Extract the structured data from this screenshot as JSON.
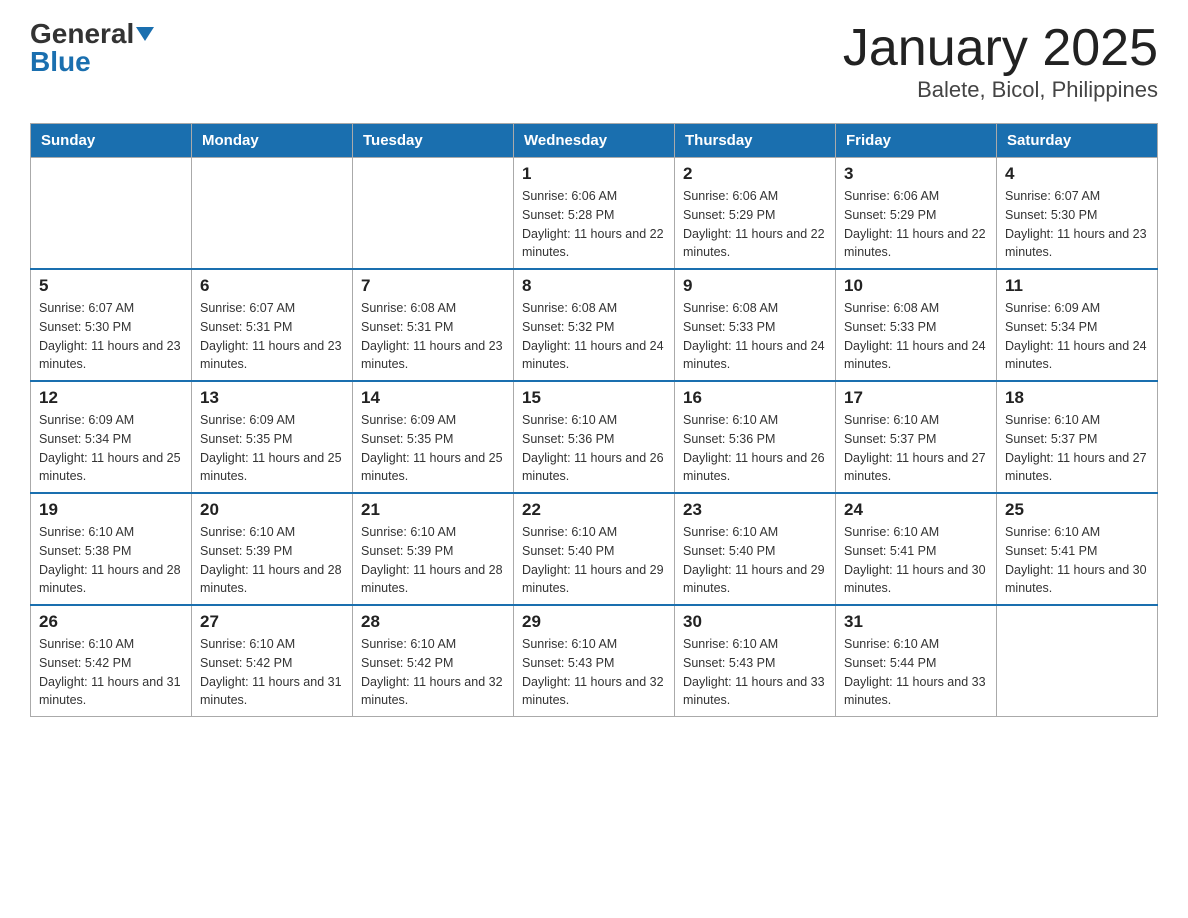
{
  "header": {
    "logo_general": "General",
    "logo_blue": "Blue",
    "title": "January 2025",
    "subtitle": "Balete, Bicol, Philippines"
  },
  "days_of_week": [
    "Sunday",
    "Monday",
    "Tuesday",
    "Wednesday",
    "Thursday",
    "Friday",
    "Saturday"
  ],
  "weeks": [
    [
      {
        "day": "",
        "sunrise": "",
        "sunset": "",
        "daylight": ""
      },
      {
        "day": "",
        "sunrise": "",
        "sunset": "",
        "daylight": ""
      },
      {
        "day": "",
        "sunrise": "",
        "sunset": "",
        "daylight": ""
      },
      {
        "day": "1",
        "sunrise": "Sunrise: 6:06 AM",
        "sunset": "Sunset: 5:28 PM",
        "daylight": "Daylight: 11 hours and 22 minutes."
      },
      {
        "day": "2",
        "sunrise": "Sunrise: 6:06 AM",
        "sunset": "Sunset: 5:29 PM",
        "daylight": "Daylight: 11 hours and 22 minutes."
      },
      {
        "day": "3",
        "sunrise": "Sunrise: 6:06 AM",
        "sunset": "Sunset: 5:29 PM",
        "daylight": "Daylight: 11 hours and 22 minutes."
      },
      {
        "day": "4",
        "sunrise": "Sunrise: 6:07 AM",
        "sunset": "Sunset: 5:30 PM",
        "daylight": "Daylight: 11 hours and 23 minutes."
      }
    ],
    [
      {
        "day": "5",
        "sunrise": "Sunrise: 6:07 AM",
        "sunset": "Sunset: 5:30 PM",
        "daylight": "Daylight: 11 hours and 23 minutes."
      },
      {
        "day": "6",
        "sunrise": "Sunrise: 6:07 AM",
        "sunset": "Sunset: 5:31 PM",
        "daylight": "Daylight: 11 hours and 23 minutes."
      },
      {
        "day": "7",
        "sunrise": "Sunrise: 6:08 AM",
        "sunset": "Sunset: 5:31 PM",
        "daylight": "Daylight: 11 hours and 23 minutes."
      },
      {
        "day": "8",
        "sunrise": "Sunrise: 6:08 AM",
        "sunset": "Sunset: 5:32 PM",
        "daylight": "Daylight: 11 hours and 24 minutes."
      },
      {
        "day": "9",
        "sunrise": "Sunrise: 6:08 AM",
        "sunset": "Sunset: 5:33 PM",
        "daylight": "Daylight: 11 hours and 24 minutes."
      },
      {
        "day": "10",
        "sunrise": "Sunrise: 6:08 AM",
        "sunset": "Sunset: 5:33 PM",
        "daylight": "Daylight: 11 hours and 24 minutes."
      },
      {
        "day": "11",
        "sunrise": "Sunrise: 6:09 AM",
        "sunset": "Sunset: 5:34 PM",
        "daylight": "Daylight: 11 hours and 24 minutes."
      }
    ],
    [
      {
        "day": "12",
        "sunrise": "Sunrise: 6:09 AM",
        "sunset": "Sunset: 5:34 PM",
        "daylight": "Daylight: 11 hours and 25 minutes."
      },
      {
        "day": "13",
        "sunrise": "Sunrise: 6:09 AM",
        "sunset": "Sunset: 5:35 PM",
        "daylight": "Daylight: 11 hours and 25 minutes."
      },
      {
        "day": "14",
        "sunrise": "Sunrise: 6:09 AM",
        "sunset": "Sunset: 5:35 PM",
        "daylight": "Daylight: 11 hours and 25 minutes."
      },
      {
        "day": "15",
        "sunrise": "Sunrise: 6:10 AM",
        "sunset": "Sunset: 5:36 PM",
        "daylight": "Daylight: 11 hours and 26 minutes."
      },
      {
        "day": "16",
        "sunrise": "Sunrise: 6:10 AM",
        "sunset": "Sunset: 5:36 PM",
        "daylight": "Daylight: 11 hours and 26 minutes."
      },
      {
        "day": "17",
        "sunrise": "Sunrise: 6:10 AM",
        "sunset": "Sunset: 5:37 PM",
        "daylight": "Daylight: 11 hours and 27 minutes."
      },
      {
        "day": "18",
        "sunrise": "Sunrise: 6:10 AM",
        "sunset": "Sunset: 5:37 PM",
        "daylight": "Daylight: 11 hours and 27 minutes."
      }
    ],
    [
      {
        "day": "19",
        "sunrise": "Sunrise: 6:10 AM",
        "sunset": "Sunset: 5:38 PM",
        "daylight": "Daylight: 11 hours and 28 minutes."
      },
      {
        "day": "20",
        "sunrise": "Sunrise: 6:10 AM",
        "sunset": "Sunset: 5:39 PM",
        "daylight": "Daylight: 11 hours and 28 minutes."
      },
      {
        "day": "21",
        "sunrise": "Sunrise: 6:10 AM",
        "sunset": "Sunset: 5:39 PM",
        "daylight": "Daylight: 11 hours and 28 minutes."
      },
      {
        "day": "22",
        "sunrise": "Sunrise: 6:10 AM",
        "sunset": "Sunset: 5:40 PM",
        "daylight": "Daylight: 11 hours and 29 minutes."
      },
      {
        "day": "23",
        "sunrise": "Sunrise: 6:10 AM",
        "sunset": "Sunset: 5:40 PM",
        "daylight": "Daylight: 11 hours and 29 minutes."
      },
      {
        "day": "24",
        "sunrise": "Sunrise: 6:10 AM",
        "sunset": "Sunset: 5:41 PM",
        "daylight": "Daylight: 11 hours and 30 minutes."
      },
      {
        "day": "25",
        "sunrise": "Sunrise: 6:10 AM",
        "sunset": "Sunset: 5:41 PM",
        "daylight": "Daylight: 11 hours and 30 minutes."
      }
    ],
    [
      {
        "day": "26",
        "sunrise": "Sunrise: 6:10 AM",
        "sunset": "Sunset: 5:42 PM",
        "daylight": "Daylight: 11 hours and 31 minutes."
      },
      {
        "day": "27",
        "sunrise": "Sunrise: 6:10 AM",
        "sunset": "Sunset: 5:42 PM",
        "daylight": "Daylight: 11 hours and 31 minutes."
      },
      {
        "day": "28",
        "sunrise": "Sunrise: 6:10 AM",
        "sunset": "Sunset: 5:42 PM",
        "daylight": "Daylight: 11 hours and 32 minutes."
      },
      {
        "day": "29",
        "sunrise": "Sunrise: 6:10 AM",
        "sunset": "Sunset: 5:43 PM",
        "daylight": "Daylight: 11 hours and 32 minutes."
      },
      {
        "day": "30",
        "sunrise": "Sunrise: 6:10 AM",
        "sunset": "Sunset: 5:43 PM",
        "daylight": "Daylight: 11 hours and 33 minutes."
      },
      {
        "day": "31",
        "sunrise": "Sunrise: 6:10 AM",
        "sunset": "Sunset: 5:44 PM",
        "daylight": "Daylight: 11 hours and 33 minutes."
      },
      {
        "day": "",
        "sunrise": "",
        "sunset": "",
        "daylight": ""
      }
    ]
  ]
}
